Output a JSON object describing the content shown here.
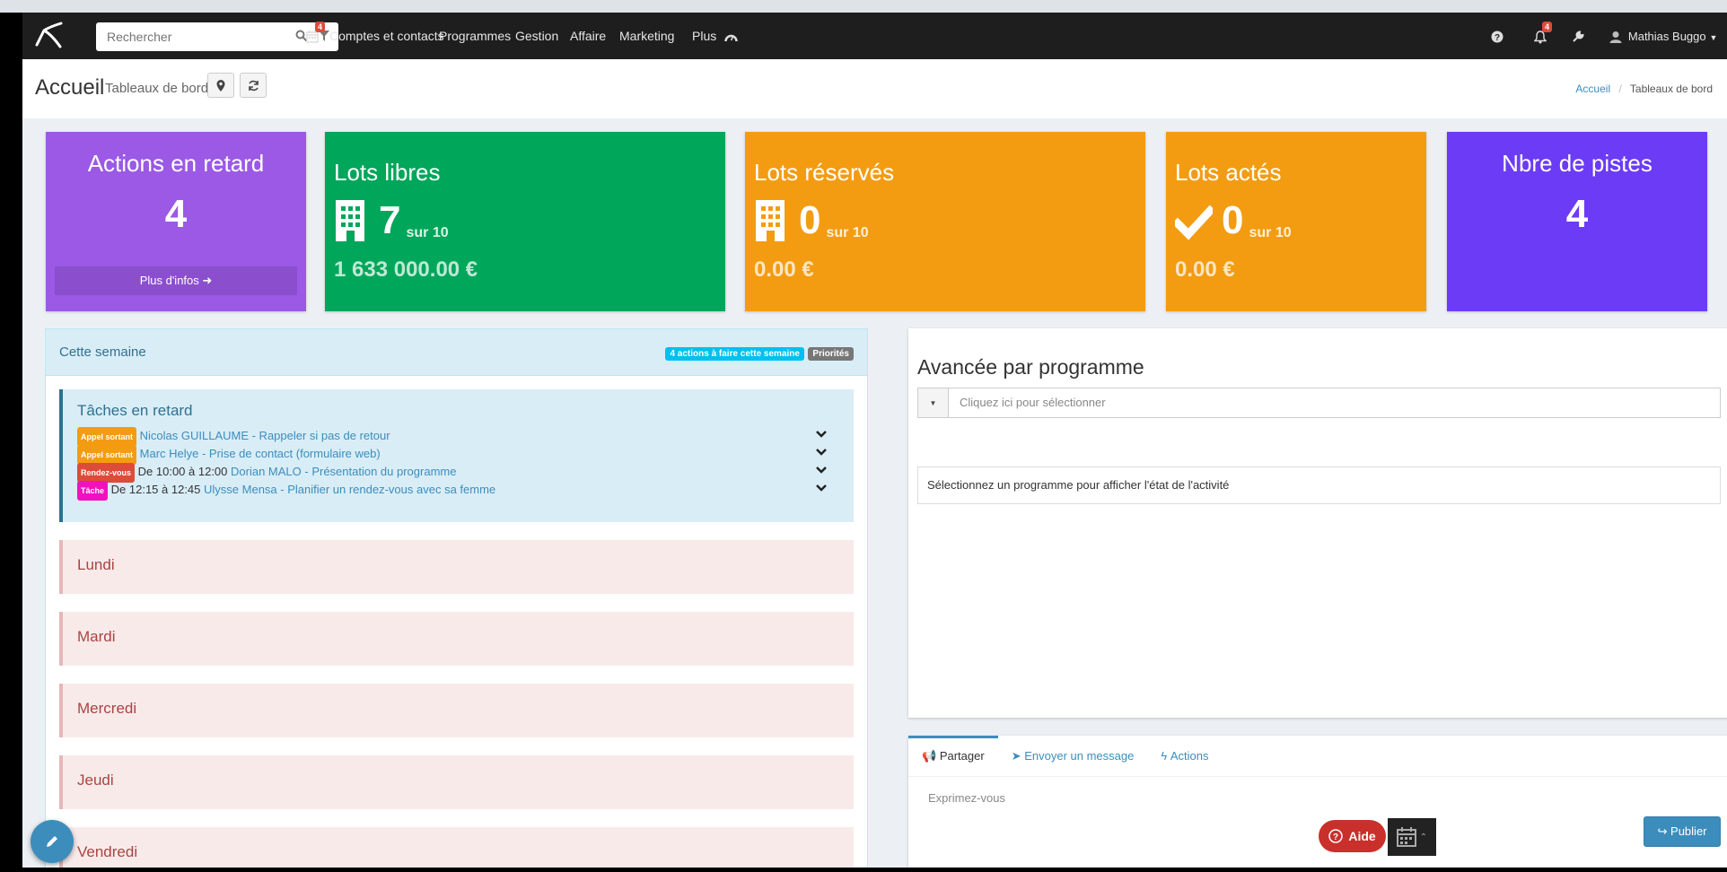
{
  "navbar": {
    "search_placeholder": "Rechercher",
    "calendar_badge": "4",
    "menu": [
      "Comptes et contacts",
      "Programmes",
      "Gestion",
      "Affaire",
      "Marketing",
      "Plus"
    ],
    "notif_badge": "4",
    "user_name": "Mathias Buggo"
  },
  "header": {
    "title": "Accueil",
    "subtitle": "Tableaux de bord",
    "breadcrumb_home": "Accueil",
    "breadcrumb_sep": "/",
    "breadcrumb_current": "Tableaux de bord"
  },
  "stats": {
    "late_actions": {
      "title": "Actions en retard",
      "value": "4",
      "more": "Plus d'infos",
      "color": "#9b59e6"
    },
    "free_lots": {
      "title": "Lots libres",
      "value": "7",
      "of": "sur 10",
      "amount": "1 633 000.00 €",
      "color": "#00a65a"
    },
    "reserved_lots": {
      "title": "Lots réservés",
      "value": "0",
      "of": "sur 10",
      "amount": "0.00 €",
      "color": "#f39c12"
    },
    "acted_lots": {
      "title": "Lots actés",
      "value": "0",
      "of": "sur 10",
      "amount": "0.00 €",
      "color": "#f39c12"
    },
    "leads": {
      "title": "Nbre de pistes",
      "value": "4",
      "color": "#6c3bf6"
    }
  },
  "week": {
    "title": "Cette semaine",
    "badge_actions": "4 actions à faire cette semaine",
    "badge_priorities": "Priorités",
    "late_title": "Tâches en retard",
    "tasks": [
      {
        "type": "Appel sortant",
        "type_color": "#f39c12",
        "time": "",
        "text": "Nicolas GUILLAUME - Rappeler si pas de retour"
      },
      {
        "type": "Appel sortant",
        "type_color": "#f39c12",
        "time": "",
        "text": "Marc Helye - Prise de contact (formulaire web)"
      },
      {
        "type": "Rendez-vous",
        "type_color": "#dd4b39",
        "time": "De 10:00 à 12:00",
        "text": "Dorian MALO - Présentation du programme"
      },
      {
        "type": "Tâche",
        "type_color": "#f012be",
        "time": "De 12:15 à 12:45",
        "text": "Ulysse Mensa - Planifier un rendez-vous avec sa femme"
      }
    ],
    "days": [
      "Lundi",
      "Mardi",
      "Mercredi",
      "Jeudi",
      "Vendredi"
    ]
  },
  "progress": {
    "title": "Avancée par programme",
    "select_placeholder": "Cliquez ici pour sélectionner",
    "info": "Sélectionnez un programme pour afficher l'état de l'activité"
  },
  "share": {
    "tabs": [
      "Partager",
      "Envoyer un message",
      "Actions"
    ],
    "placeholder": "Exprimez-vous",
    "publish": "Publier"
  },
  "help_label": "Aide"
}
